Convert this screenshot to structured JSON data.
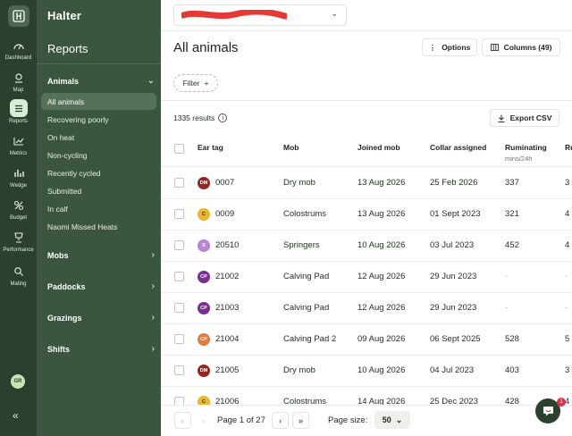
{
  "rail": {
    "items": [
      {
        "label": "Dashboard",
        "icon": "gauge-icon"
      },
      {
        "label": "Map",
        "icon": "map-pin-icon"
      },
      {
        "label": "Reports",
        "icon": "list-icon"
      },
      {
        "label": "Metrics",
        "icon": "line-chart-icon"
      },
      {
        "label": "Wedge",
        "icon": "bar-chart-icon"
      },
      {
        "label": "Budget",
        "icon": "budget-icon"
      },
      {
        "label": "Performance",
        "icon": "trophy-icon"
      },
      {
        "label": "Mating",
        "icon": "mating-icon"
      }
    ],
    "avatar": "GR",
    "collapse": "«"
  },
  "nav": {
    "brand": "Halter",
    "title": "Reports",
    "animals_label": "Animals",
    "animals_items": [
      "All animals",
      "Recovering poorly",
      "On heat",
      "Non-cycling",
      "Recently cycled",
      "Submitted",
      "In calf",
      "Naomi Missed Heats"
    ],
    "sections": [
      "Mobs",
      "Paddocks",
      "Grazings",
      "Shifts"
    ]
  },
  "header": {
    "page_title": "All animals",
    "options_label": "Options",
    "columns_label": "Columns (49)",
    "filter_label": "Filter",
    "results": "1335 results",
    "export_label": "Export CSV"
  },
  "table": {
    "columns": [
      "Ear tag",
      "Mob",
      "Joined mob",
      "Collar assigned",
      "Ruminating",
      "Ru"
    ],
    "ruminating_unit": "mins/24h",
    "rows": [
      {
        "badge": "DM",
        "tag": "0007",
        "mob": "Dry mob",
        "joined": "13 Aug 2026",
        "collar": "25 Feb 2026",
        "rum": "337",
        "next": "3"
      },
      {
        "badge": "C",
        "tag": "0009",
        "mob": "Colostrums",
        "joined": "13 Aug 2026",
        "collar": "01 Sept 2023",
        "rum": "321",
        "next": "4"
      },
      {
        "badge": "S",
        "tag": "20510",
        "mob": "Springers",
        "joined": "10 Aug 2026",
        "collar": "03 Jul 2023",
        "rum": "452",
        "next": "4"
      },
      {
        "badge": "CP",
        "tag": "21002",
        "mob": "Calving Pad",
        "joined": "12 Aug 2026",
        "collar": "29 Jun 2023",
        "rum": "-",
        "next": "-"
      },
      {
        "badge": "CP",
        "tag": "21003",
        "mob": "Calving Pad",
        "joined": "12 Aug 2026",
        "collar": "29 Jun 2023",
        "rum": "-",
        "next": "-"
      },
      {
        "badge": "CP",
        "tag": "21004",
        "mob": "Calving Pad 2",
        "joined": "09 Aug 2026",
        "collar": "06 Sept 2025",
        "rum": "528",
        "next": "5"
      },
      {
        "badge": "DM",
        "tag": "21005",
        "mob": "Dry mob",
        "joined": "10 Aug 2026",
        "collar": "04 Jul 2023",
        "rum": "403",
        "next": "3"
      },
      {
        "badge": "C",
        "tag": "21006",
        "mob": "Colostrums",
        "joined": "14 Aug 2026",
        "collar": "25 Dec 2023",
        "rum": "428",
        "next": "4"
      }
    ]
  },
  "pager": {
    "first": "«",
    "prev": "‹",
    "page_text": "Page 1 of 27",
    "next": "›",
    "last": "»",
    "size_label": "Page size:",
    "size_value": "50"
  },
  "chat_badge": "1",
  "colors": {
    "rail_bg": "#2b402f",
    "nav_bg": "#3a5640",
    "active_item": "#55715a",
    "badge_DM": "#8e2a22",
    "badge_C": "#e9b730",
    "badge_S": "#b784d6",
    "badge_CP": "#7b2f8e",
    "badge_CP2": "#e07a3e",
    "chat_badge": "#e0314b"
  }
}
